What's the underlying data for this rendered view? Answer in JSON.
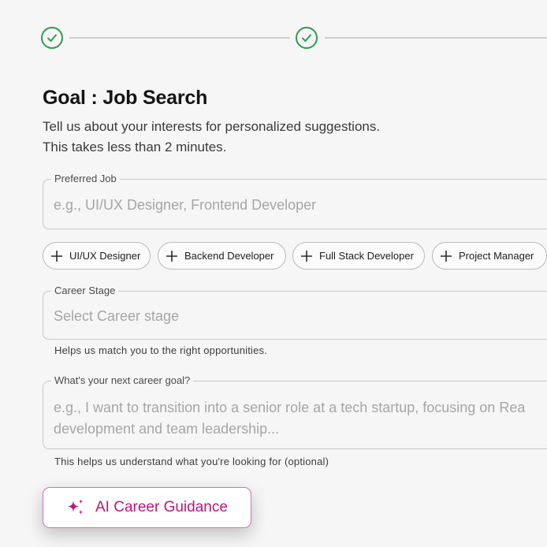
{
  "stepper": {
    "steps": [
      {
        "icon": "check-circle-icon",
        "state": "completed"
      },
      {
        "icon": "check-circle-icon",
        "state": "completed"
      }
    ],
    "accent_color": "#2f9a4f"
  },
  "header": {
    "title": "Goal : Job Search",
    "subtitle_line1": "Tell us  about your interests for personalized suggestions.",
    "subtitle_line2": "This takes less than 2 minutes."
  },
  "preferred_job": {
    "label": "Preferred Job",
    "placeholder": "e.g., UI/UX Designer, Frontend Developer",
    "suggestions": [
      {
        "icon": "plus-icon",
        "label": "UI/UX Designer"
      },
      {
        "icon": "plus-icon",
        "label": "Backend Developer"
      },
      {
        "icon": "plus-icon",
        "label": "Full Stack Developer"
      },
      {
        "icon": "plus-icon",
        "label": "Project Manager"
      }
    ]
  },
  "career_stage": {
    "label": "Career Stage",
    "placeholder": "Select Career stage",
    "helper": "Helps us match you to the right opportunities."
  },
  "career_goal": {
    "label": "What's your next career goal?",
    "placeholder_line1": "e.g., I want to transition into a senior role at a tech startup, focusing on Rea",
    "placeholder_line2": "development and team leadership...",
    "helper": "This helps us understand what you're looking for (optional)"
  },
  "ai_button": {
    "icon": "sparkles-icon",
    "label": "AI Career Guidance",
    "color": "#c0137f"
  }
}
